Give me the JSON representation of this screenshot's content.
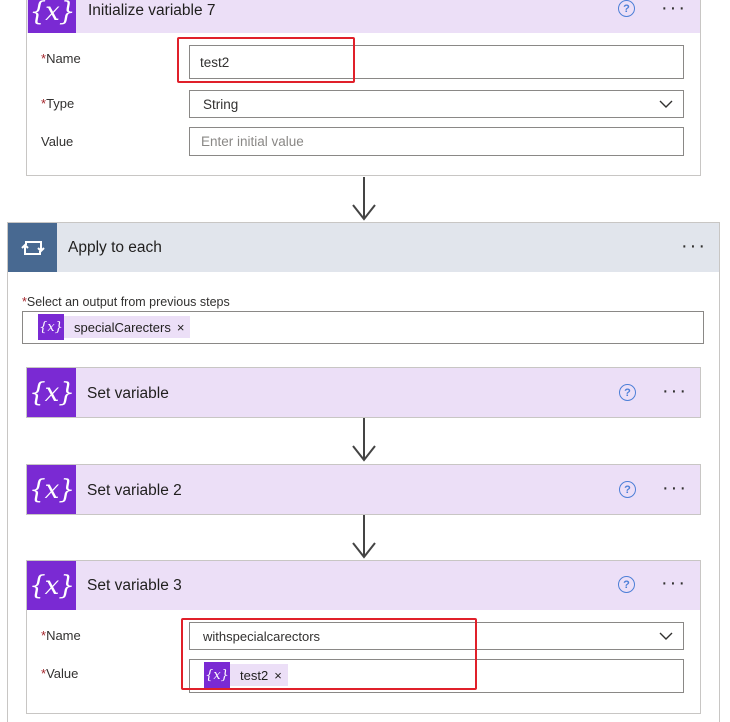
{
  "init_var": {
    "title": "Initialize variable 7",
    "name_label": "Name",
    "name_value": "test2",
    "type_label": "Type",
    "type_value": "String",
    "value_label": "Value",
    "value_placeholder": "Enter initial value"
  },
  "apply_each": {
    "title": "Apply to each",
    "select_label": "Select an output from previous steps",
    "token_text": "specialCarecters"
  },
  "set_var1": {
    "title": "Set variable"
  },
  "set_var2": {
    "title": "Set variable 2"
  },
  "set_var3": {
    "title": "Set variable 3",
    "name_label": "Name",
    "name_value": "withspecialcarectors",
    "value_label": "Value",
    "token_text": "test2"
  },
  "common": {
    "required_mark": "*",
    "help_glyph": "?",
    "more_glyph": "···",
    "var_icon_glyph": "{x}",
    "token_remove_glyph": "×",
    "chevron_glyph": "⌵"
  },
  "colors": {
    "accent_purple": "#7a2ad3",
    "header_lavender": "#ecdff7",
    "loop_blue": "#486991",
    "highlight_red": "#e0202a",
    "help_blue": "#4d7fd7"
  }
}
